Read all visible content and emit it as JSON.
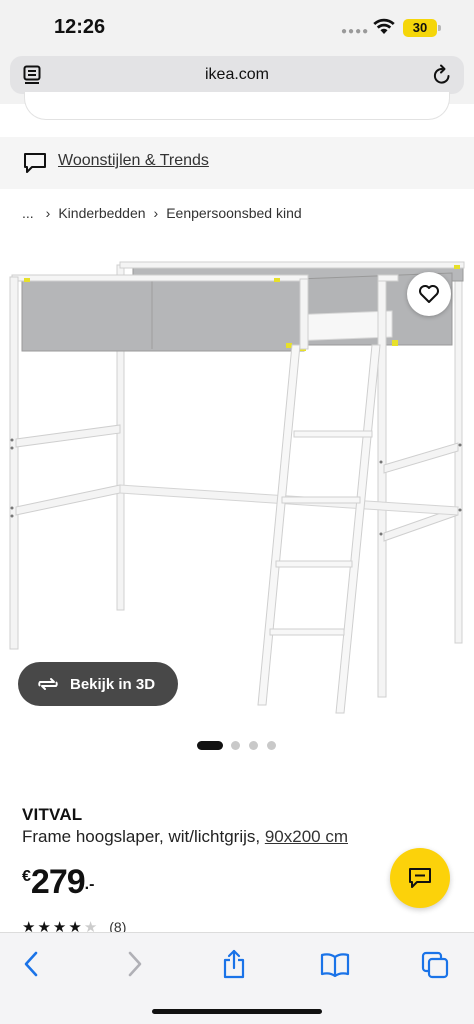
{
  "status_bar": {
    "time": "12:26",
    "battery": "30"
  },
  "browser": {
    "url": "ikea.com"
  },
  "nav_link": {
    "label": "Woonstijlen & Trends"
  },
  "breadcrumb": {
    "ellipsis": "...",
    "items": [
      "Kinderbedden",
      "Eenpersoonsbed kind"
    ]
  },
  "gallery": {
    "view_3d_label": "Bekijk in 3D",
    "page_count": 4,
    "active_index": 0
  },
  "product": {
    "brand": "VITVAL",
    "description": "Frame hoogslaper, wit/lichtgrijs,",
    "size": "90x200 cm",
    "currency": "€",
    "price": "279",
    "price_suffix": ".-",
    "rating_stars": 4,
    "rating_count": "(8)"
  },
  "colors": {
    "accent_yellow": "#fcd20a",
    "dark_button": "#484848"
  }
}
